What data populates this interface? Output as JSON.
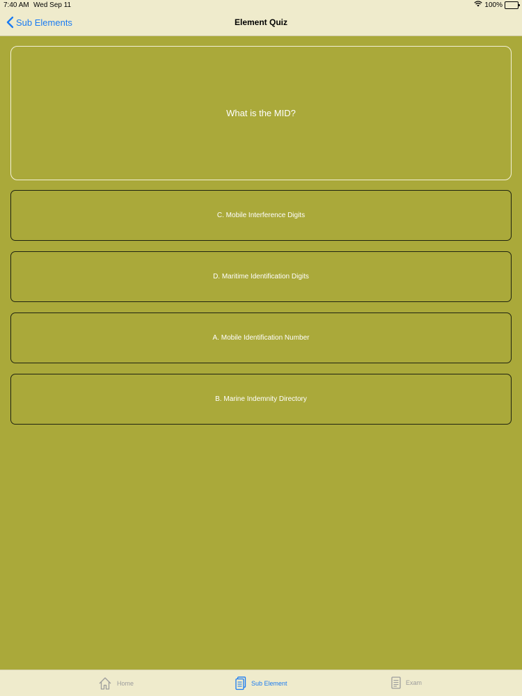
{
  "status": {
    "time": "7:40 AM",
    "date": "Wed Sep 11",
    "battery": "100%"
  },
  "nav": {
    "back_label": "Sub Elements",
    "title": "Element Quiz"
  },
  "question": {
    "text": "What is the MID?"
  },
  "answers": [
    {
      "label": "C. Mobile Interference Digits"
    },
    {
      "label": "D. Maritime Identification Digits"
    },
    {
      "label": "A. Mobile Identification Number"
    },
    {
      "label": "B. Marine Indemnity Directory"
    }
  ],
  "tabs": [
    {
      "label": "Home",
      "icon": "home-icon"
    },
    {
      "label": "Sub Element",
      "icon": "document-stack-icon",
      "selected": true
    },
    {
      "label": "Exam",
      "icon": "document-icon"
    }
  ],
  "colors": {
    "background": "#aaa93a",
    "bars": "#efebcc",
    "accent": "#1a7bf2",
    "inactive_tab": "#9c9c9c"
  }
}
